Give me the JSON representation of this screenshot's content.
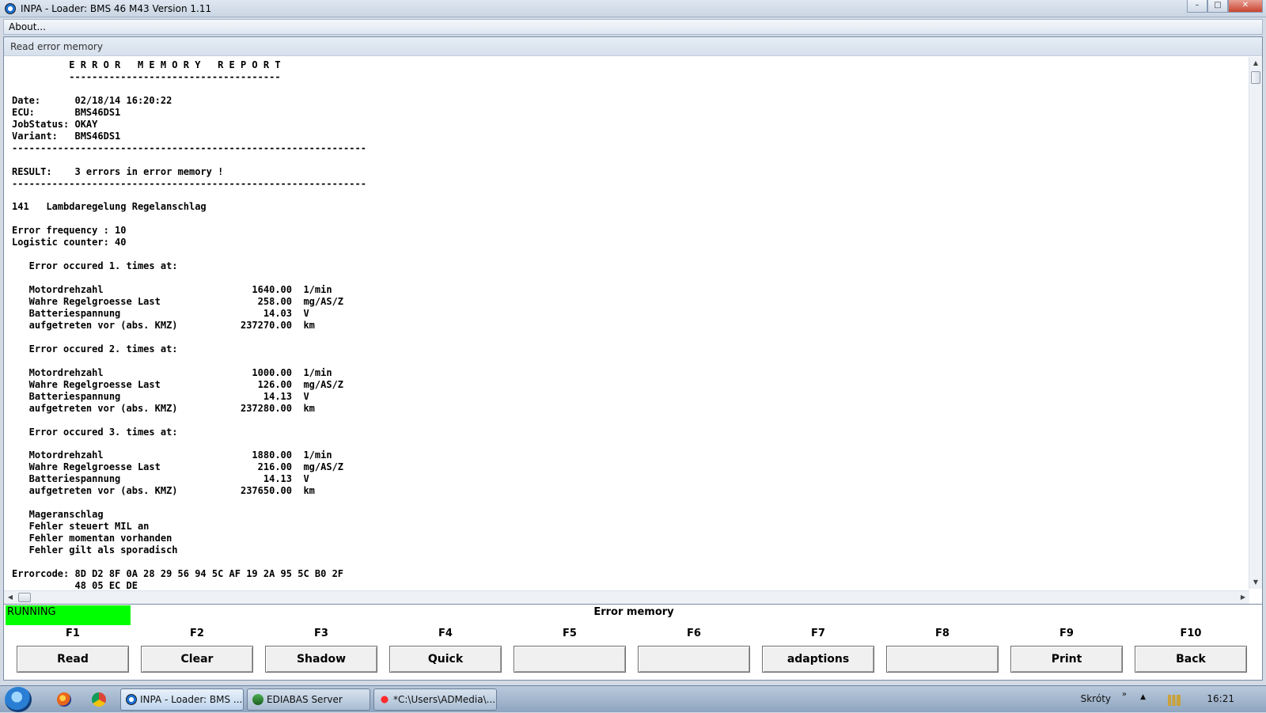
{
  "window": {
    "title": "INPA - Loader:  BMS 46 M43 Version 1.11",
    "controls": {
      "minimize": "–",
      "maximize": "□",
      "close": "✕"
    }
  },
  "menu": {
    "about": "About..."
  },
  "panel": {
    "title": "Read error memory"
  },
  "report": {
    "lines": [
      "          E R R O R   M E M O R Y   R E P O R T",
      "          -------------------------------------",
      "",
      "Date:      02/18/14 16:20:22",
      "ECU:       BMS46DS1",
      "JobStatus: OKAY",
      "Variant:   BMS46DS1",
      "--------------------------------------------------------------",
      "",
      "RESULT:    3 errors in error memory !",
      "--------------------------------------------------------------",
      "",
      "141   Lambdaregelung Regelanschlag",
      "",
      "Error frequency : 10",
      "Logistic counter: 40",
      "",
      "   Error occured 1. times at:",
      "",
      "   Motordrehzahl                          1640.00  1/min",
      "   Wahre Regelgroesse Last                 258.00  mg/AS/Z",
      "   Batteriespannung                         14.03  V",
      "   aufgetreten vor (abs. KMZ)           237270.00  km",
      "",
      "   Error occured 2. times at:",
      "",
      "   Motordrehzahl                          1000.00  1/min",
      "   Wahre Regelgroesse Last                 126.00  mg/AS/Z",
      "   Batteriespannung                         14.13  V",
      "   aufgetreten vor (abs. KMZ)           237280.00  km",
      "",
      "   Error occured 3. times at:",
      "",
      "   Motordrehzahl                          1880.00  1/min",
      "   Wahre Regelgroesse Last                 216.00  mg/AS/Z",
      "   Batteriespannung                         14.13  V",
      "   aufgetreten vor (abs. KMZ)           237650.00  km",
      "",
      "   Mageranschlag",
      "   Fehler steuert MIL an",
      "   Fehler momentan vorhanden",
      "   Fehler gilt als sporadisch",
      "",
      "Errorcode: 8D D2 8F 0A 28 29 56 94 5C AF 19 2A 95 5C B0 2F",
      "           48 05 EC DE"
    ]
  },
  "status": {
    "running": "RUNNING",
    "title": "Error memory"
  },
  "fkeys": [
    {
      "key": "F1",
      "label": "Read"
    },
    {
      "key": "F2",
      "label": "Clear"
    },
    {
      "key": "F3",
      "label": "Shadow"
    },
    {
      "key": "F4",
      "label": "Quick"
    },
    {
      "key": "F5",
      "label": ""
    },
    {
      "key": "F6",
      "label": ""
    },
    {
      "key": "F7",
      "label": "adaptions"
    },
    {
      "key": "F8",
      "label": ""
    },
    {
      "key": "F9",
      "label": "Print"
    },
    {
      "key": "F10",
      "label": "Back"
    }
  ],
  "taskbar": {
    "items": [
      {
        "label": "INPA - Loader:  BMS ...",
        "active": true,
        "icon": "bmw-icon"
      },
      {
        "label": "EDIABAS Server",
        "active": false,
        "icon": "ediabas-icon"
      },
      {
        "label": "*C:\\Users\\ADMedia\\...",
        "active": false,
        "icon": "notepad-icon"
      }
    ],
    "shortcuts_label": "Skróty",
    "clock": "16:21"
  }
}
